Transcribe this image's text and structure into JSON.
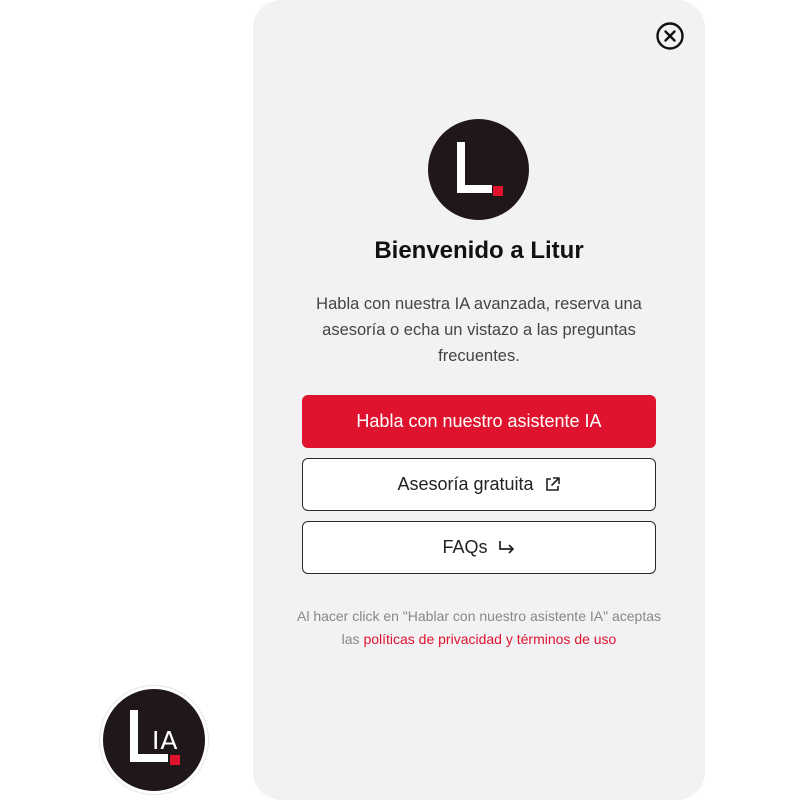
{
  "panel": {
    "title": "Bienvenido a Litur",
    "description": "Habla con nuestra IA avanzada, reserva una asesoría o echa un vistazo a las preguntas frecuentes.",
    "buttons": {
      "assistant_label": "Habla con nuestro asistente IA",
      "advice_label": "Asesoría gratuita",
      "faq_label": "FAQs"
    },
    "legal": {
      "prefix": "Al hacer click en \"Hablar con nuestro asistente IA\" aceptas las ",
      "link": "políticas de privacidad y términos de uso"
    },
    "icons": {
      "close": "close-circle-icon",
      "advice": "external-link-icon",
      "faq": "arrow-down-right-icon"
    }
  },
  "launcher": {
    "text": "IA"
  },
  "colors": {
    "accent": "#e0132f",
    "logo_bg": "#1f1718",
    "panel_bg": "#f2f2f4"
  }
}
